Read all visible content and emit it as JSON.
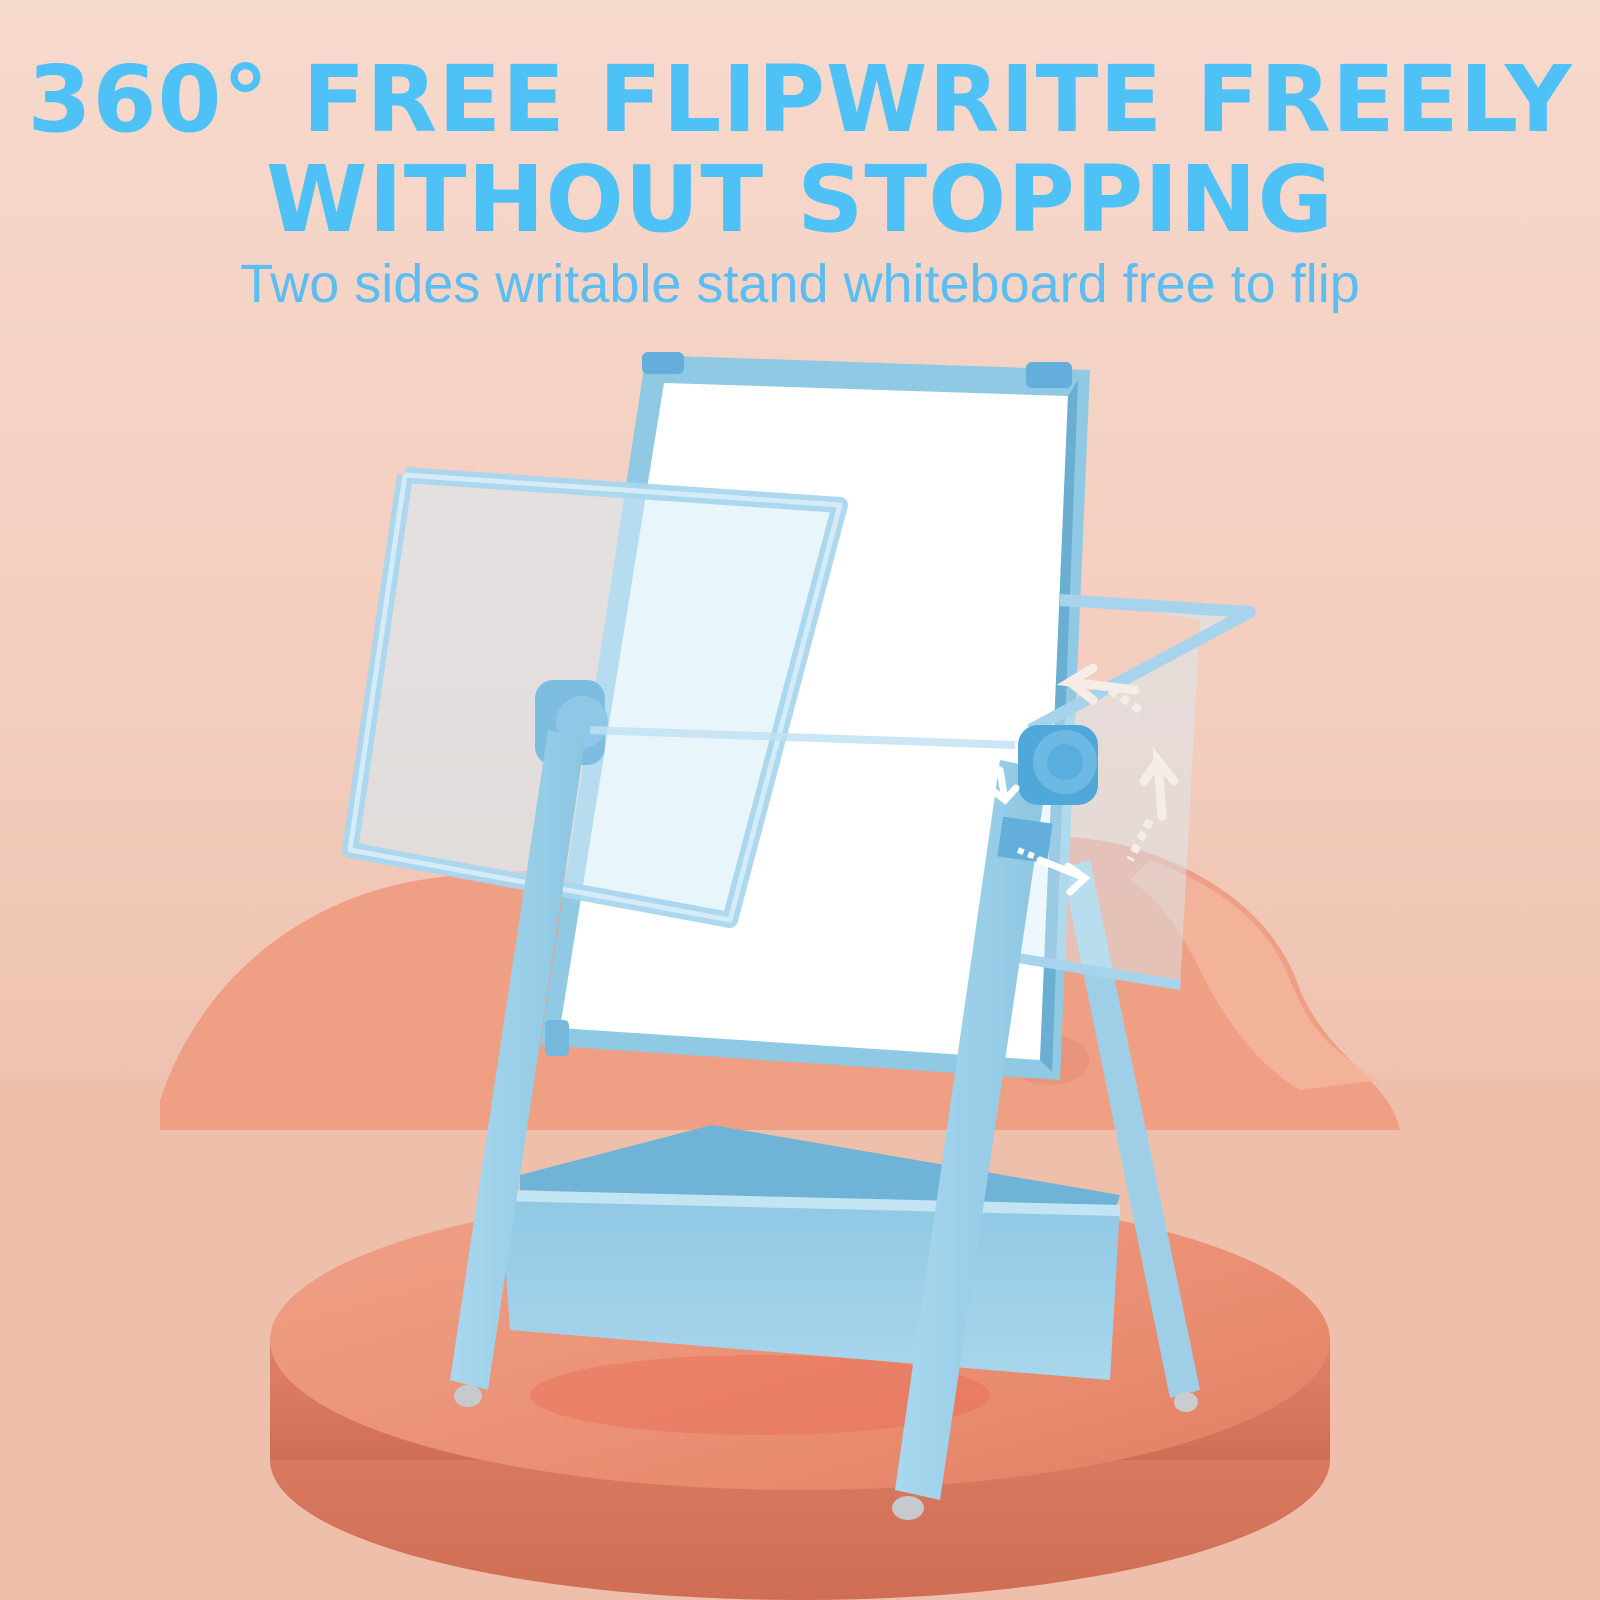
{
  "headline": {
    "line1": "360° FREE FLIPWRITE FREELY",
    "line2": "WITHOUT STOPPING"
  },
  "subheadline": "Two sides writable stand whiteboard free to flip",
  "colors": {
    "headline": "#4ec2f6",
    "subheadline": "#5bbdf2",
    "background": "#f3cdbd",
    "pedestal": "#e98c6e",
    "frame": "#9fd1ea",
    "board": "#ffffff"
  },
  "icons": [
    "rotation-arrow-icon"
  ]
}
